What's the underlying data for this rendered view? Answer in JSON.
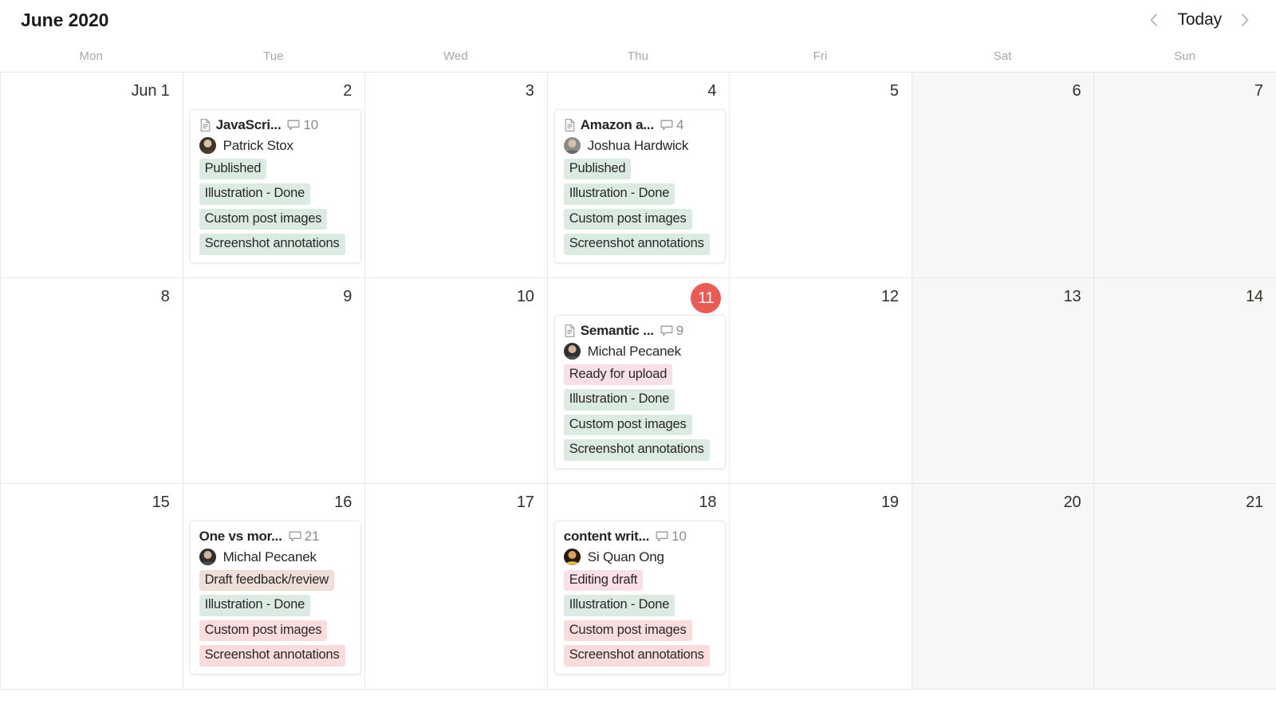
{
  "header": {
    "month_title": "June 2020",
    "prev_label": "‹",
    "today_label": "Today",
    "next_label": "›"
  },
  "weekdays": [
    "Mon",
    "Tue",
    "Wed",
    "Thu",
    "Fri",
    "Sat",
    "Sun"
  ],
  "colors": {
    "today_badge": "#ea5b54",
    "tag_green": "#dcebe2",
    "tag_pink": "#f9dfe8",
    "tag_red": "#fbdcdc",
    "tag_brown": "#eedfd8",
    "weekend_bg": "#f7f7f5",
    "grid_line": "#e7e7e5"
  },
  "weeks": [
    {
      "days": [
        {
          "label": "Jun 1",
          "weekend": false,
          "today": false,
          "events": []
        },
        {
          "label": "2",
          "weekend": false,
          "today": false,
          "events": [
            {
              "has_doc_icon": true,
              "title": "JavaScri...",
              "comment_icon": "comment-icon",
              "comments": "10",
              "person": "Patrick Stox",
              "avatar": "avatar-patrick-stox",
              "tags": [
                {
                  "label": "Published",
                  "color": "green"
                },
                {
                  "label": "Illustration - Done",
                  "color": "green"
                },
                {
                  "label": "Custom post images",
                  "color": "green"
                },
                {
                  "label": "Screenshot annotations",
                  "color": "green"
                }
              ]
            }
          ]
        },
        {
          "label": "3",
          "weekend": false,
          "today": false,
          "events": []
        },
        {
          "label": "4",
          "weekend": false,
          "today": false,
          "events": [
            {
              "has_doc_icon": true,
              "title": "Amazon a...",
              "comment_icon": "comment-icon",
              "comments": "4",
              "person": "Joshua Hardwick",
              "avatar": "avatar-joshua-hardwick",
              "tags": [
                {
                  "label": "Published",
                  "color": "green"
                },
                {
                  "label": "Illustration - Done",
                  "color": "green"
                },
                {
                  "label": "Custom post images",
                  "color": "green"
                },
                {
                  "label": "Screenshot annotations",
                  "color": "green"
                }
              ]
            }
          ]
        },
        {
          "label": "5",
          "weekend": false,
          "today": false,
          "events": []
        },
        {
          "label": "6",
          "weekend": true,
          "today": false,
          "events": []
        },
        {
          "label": "7",
          "weekend": true,
          "today": false,
          "events": []
        }
      ]
    },
    {
      "days": [
        {
          "label": "8",
          "weekend": false,
          "today": false,
          "events": []
        },
        {
          "label": "9",
          "weekend": false,
          "today": false,
          "events": []
        },
        {
          "label": "10",
          "weekend": false,
          "today": false,
          "events": []
        },
        {
          "label": "11",
          "weekend": false,
          "today": true,
          "events": [
            {
              "has_doc_icon": true,
              "title": "Semantic ...",
              "comment_icon": "comment-icon",
              "comments": "9",
              "person": "Michal Pecanek",
              "avatar": "avatar-michal-pecanek",
              "tags": [
                {
                  "label": "Ready for upload",
                  "color": "pink"
                },
                {
                  "label": "Illustration - Done",
                  "color": "green"
                },
                {
                  "label": "Custom post images",
                  "color": "green"
                },
                {
                  "label": "Screenshot annotations",
                  "color": "green"
                }
              ]
            }
          ]
        },
        {
          "label": "12",
          "weekend": false,
          "today": false,
          "events": []
        },
        {
          "label": "13",
          "weekend": true,
          "today": false,
          "events": []
        },
        {
          "label": "14",
          "weekend": true,
          "today": false,
          "events": []
        }
      ]
    },
    {
      "days": [
        {
          "label": "15",
          "weekend": false,
          "today": false,
          "events": []
        },
        {
          "label": "16",
          "weekend": false,
          "today": false,
          "events": [
            {
              "has_doc_icon": false,
              "title": "One vs mor...",
              "comment_icon": "comment-icon",
              "comments": "21",
              "person": "Michal Pecanek",
              "avatar": "avatar-michal-pecanek",
              "tags": [
                {
                  "label": "Draft feedback/review",
                  "color": "brown"
                },
                {
                  "label": "Illustration - Done",
                  "color": "green"
                },
                {
                  "label": "Custom post images",
                  "color": "red"
                },
                {
                  "label": "Screenshot annotations",
                  "color": "red"
                }
              ]
            }
          ]
        },
        {
          "label": "17",
          "weekend": false,
          "today": false,
          "events": []
        },
        {
          "label": "18",
          "weekend": false,
          "today": false,
          "events": [
            {
              "has_doc_icon": false,
              "title": "content writ...",
              "comment_icon": "comment-icon",
              "comments": "10",
              "person": "Si Quan Ong",
              "avatar": "avatar-si-quan-ong",
              "tags": [
                {
                  "label": "Editing draft",
                  "color": "pink"
                },
                {
                  "label": "Illustration - Done",
                  "color": "green"
                },
                {
                  "label": "Custom post images",
                  "color": "red"
                },
                {
                  "label": "Screenshot annotations",
                  "color": "red"
                }
              ]
            }
          ]
        },
        {
          "label": "19",
          "weekend": false,
          "today": false,
          "events": []
        },
        {
          "label": "20",
          "weekend": true,
          "today": false,
          "events": []
        },
        {
          "label": "21",
          "weekend": true,
          "today": false,
          "events": []
        }
      ]
    }
  ]
}
